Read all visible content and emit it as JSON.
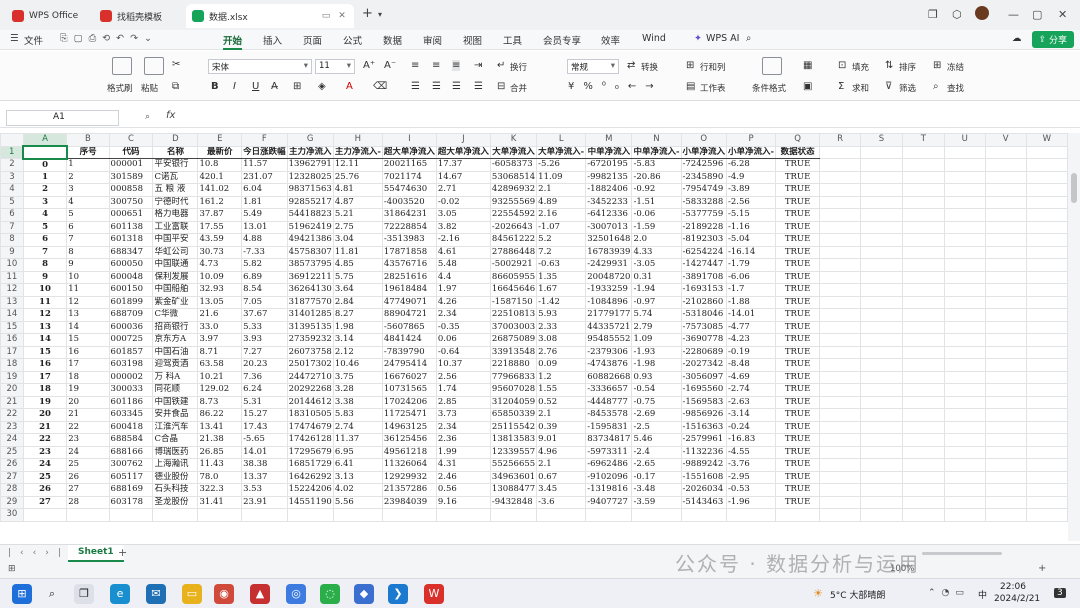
{
  "tabs": [
    {
      "label": "WPS Office",
      "color": "#d9302c"
    },
    {
      "label": "找稻壳模板",
      "color": "#d9302c"
    },
    {
      "label": "数据.xlsx",
      "color": "#16a35a"
    }
  ],
  "menu": [
    "文件",
    "开始",
    "插入",
    "页面",
    "公式",
    "数据",
    "审阅",
    "视图",
    "工具",
    "会员专享",
    "效率",
    "Wind"
  ],
  "wps_ai": "WPS AI",
  "share": "分享",
  "ribbon": {
    "format_brush": "格式刷",
    "paste": "粘贴",
    "font": "宋体",
    "size": "11",
    "wrap": "换行",
    "merge": "合并",
    "numfmt": "常规",
    "convert": "转换",
    "rows_cols": "行和列",
    "worksheet": "工作表",
    "cond_fmt": "条件格式",
    "fill": "填充",
    "sort": "排序",
    "freeze": "冻结",
    "sum": "求和",
    "filter": "筛选",
    "find": "查找"
  },
  "cell_ref": "A1",
  "fx": "fx",
  "col_letters": [
    "A",
    "B",
    "C",
    "D",
    "E",
    "F",
    "G",
    "H",
    "I",
    "J",
    "K",
    "L",
    "M",
    "N",
    "O",
    "P",
    "Q",
    "R",
    "S",
    "T",
    "U",
    "V",
    "W"
  ],
  "header_row": [
    "",
    "序号",
    "代码",
    "名称",
    "最新价",
    "今日涨跌幅",
    "主力净流入",
    "主力净流入-",
    "超大单净流入",
    "超大单净流入",
    "大单净流入",
    "大单净流入-",
    "中单净流入",
    "中单净流入-",
    "小单净流入",
    "小单净流入-",
    "数据状态"
  ],
  "rows": [
    [
      "0",
      "1",
      "000001",
      "平安银行",
      "10.8",
      "11.57",
      "13962791",
      "12.11",
      "20021165",
      "17.37",
      "-6058373",
      "-5.26",
      "-6720195",
      "-5.83",
      "-7242596",
      "-6.28",
      "TRUE"
    ],
    [
      "1",
      "2",
      "301589",
      "C诺瓦",
      "420.1",
      "231.07",
      "12328025",
      "25.76",
      "7021174",
      "14.67",
      "53068514",
      "11.09",
      "-9982135",
      "-20.86",
      "-2345890",
      "-4.9",
      "TRUE"
    ],
    [
      "2",
      "3",
      "000858",
      "五 粮 液",
      "141.02",
      "6.04",
      "98371563",
      "4.81",
      "55474630",
      "2.71",
      "42896932",
      "2.1",
      "-1882406",
      "-0.92",
      "-7954749",
      "-3.89",
      "TRUE"
    ],
    [
      "3",
      "4",
      "300750",
      "宁德时代",
      "161.2",
      "1.81",
      "92855217",
      "4.87",
      "-4003520",
      "-0.02",
      "93255569",
      "4.89",
      "-3452233",
      "-1.51",
      "-5833288",
      "-2.56",
      "TRUE"
    ],
    [
      "4",
      "5",
      "000651",
      "格力电器",
      "37.87",
      "5.49",
      "54418823",
      "5.21",
      "31864231",
      "3.05",
      "22554592",
      "2.16",
      "-6412336",
      "-0.06",
      "-5377759",
      "-5.15",
      "TRUE"
    ],
    [
      "5",
      "6",
      "601138",
      "工业富联",
      "17.55",
      "13.01",
      "51962419",
      "2.75",
      "72228854",
      "3.82",
      "-2026643",
      "-1.07",
      "-3007013",
      "-1.59",
      "-2189228",
      "-1.16",
      "TRUE"
    ],
    [
      "6",
      "7",
      "601318",
      "中国平安",
      "43.59",
      "4.88",
      "49421386",
      "3.04",
      "-3513983",
      "-2.16",
      "84561222",
      "5.2",
      "32501648",
      "2.0",
      "-8192303",
      "-5.04",
      "TRUE"
    ],
    [
      "7",
      "8",
      "688347",
      "华虹公司",
      "30.73",
      "-7.33",
      "45758307",
      "11.81",
      "17871858",
      "4.61",
      "27886448",
      "7.2",
      "16783939",
      "4.33",
      "-6254224",
      "-16.14",
      "TRUE"
    ],
    [
      "8",
      "9",
      "600050",
      "中国联通",
      "4.73",
      "5.82",
      "38573795",
      "4.85",
      "43576716",
      "5.48",
      "-5002921",
      "-0.63",
      "-2429931",
      "-3.05",
      "-1427447",
      "-1.79",
      "TRUE"
    ],
    [
      "9",
      "10",
      "600048",
      "保利发展",
      "10.09",
      "6.89",
      "36912211",
      "5.75",
      "28251616",
      "4.4",
      "86605955",
      "1.35",
      "20048720",
      "0.31",
      "-3891708",
      "-6.06",
      "TRUE"
    ],
    [
      "10",
      "11",
      "600150",
      "中国船舶",
      "32.93",
      "8.54",
      "36264130",
      "3.64",
      "19618484",
      "1.97",
      "16645646",
      "1.67",
      "-1933259",
      "-1.94",
      "-1693153",
      "-1.7",
      "TRUE"
    ],
    [
      "11",
      "12",
      "601899",
      "紫金矿业",
      "13.05",
      "7.05",
      "31877570",
      "2.84",
      "47749071",
      "4.26",
      "-1587150",
      "-1.42",
      "-1084896",
      "-0.97",
      "-2102860",
      "-1.88",
      "TRUE"
    ],
    [
      "12",
      "13",
      "688709",
      "C华微",
      "21.6",
      "37.67",
      "31401285",
      "8.27",
      "88904721",
      "2.34",
      "22510813",
      "5.93",
      "21779177",
      "5.74",
      "-5318046",
      "-14.01",
      "TRUE"
    ],
    [
      "13",
      "14",
      "600036",
      "招商银行",
      "33.0",
      "5.33",
      "31395135",
      "1.98",
      "-5607865",
      "-0.35",
      "37003003",
      "2.33",
      "44335721",
      "2.79",
      "-7573085",
      "-4.77",
      "TRUE"
    ],
    [
      "14",
      "15",
      "000725",
      "京东方A",
      "3.97",
      "3.93",
      "27359232",
      "3.14",
      "4841424",
      "0.06",
      "26875089",
      "3.08",
      "95485552",
      "1.09",
      "-3690778",
      "-4.23",
      "TRUE"
    ],
    [
      "15",
      "16",
      "601857",
      "中国石油",
      "8.71",
      "7.27",
      "26073758",
      "2.12",
      "-7839790",
      "-0.64",
      "33913548",
      "2.76",
      "-2379306",
      "-1.93",
      "-2280689",
      "-0.19",
      "TRUE"
    ],
    [
      "16",
      "17",
      "603198",
      "迎驾贡酒",
      "63.58",
      "20.23",
      "25017302",
      "10.46",
      "24795414",
      "10.37",
      "2218880",
      "0.09",
      "-4743876",
      "-1.98",
      "-2027342",
      "-8.48",
      "TRUE"
    ],
    [
      "17",
      "18",
      "000002",
      "万  科A",
      "10.21",
      "7.36",
      "24472710",
      "3.75",
      "16676027",
      "2.56",
      "77966833",
      "1.2",
      "60882668",
      "0.93",
      "-3056097",
      "-4.69",
      "TRUE"
    ],
    [
      "18",
      "19",
      "300033",
      "同花顺",
      "129.02",
      "6.24",
      "20292268",
      "3.28",
      "10731565",
      "1.74",
      "95607028",
      "1.55",
      "-3336657",
      "-0.54",
      "-1695560",
      "-2.74",
      "TRUE"
    ],
    [
      "19",
      "20",
      "601186",
      "中国铁建",
      "8.73",
      "5.31",
      "20144612",
      "3.38",
      "17024206",
      "2.85",
      "31204059",
      "0.52",
      "-4448777",
      "-0.75",
      "-1569583",
      "-2.63",
      "TRUE"
    ],
    [
      "20",
      "21",
      "603345",
      "安井食品",
      "86.22",
      "15.27",
      "18310505",
      "5.83",
      "11725471",
      "3.73",
      "65850339",
      "2.1",
      "-8453578",
      "-2.69",
      "-9856926",
      "-3.14",
      "TRUE"
    ],
    [
      "21",
      "22",
      "600418",
      "江淮汽车",
      "13.41",
      "17.43",
      "17474679",
      "2.74",
      "14963125",
      "2.34",
      "25115542",
      "0.39",
      "-1595831",
      "-2.5",
      "-1516363",
      "-0.24",
      "TRUE"
    ],
    [
      "22",
      "23",
      "688584",
      "C合晶",
      "21.38",
      "-5.65",
      "17426128",
      "11.37",
      "36125456",
      "2.36",
      "13813583",
      "9.01",
      "83734817",
      "5.46",
      "-2579961",
      "-16.83",
      "TRUE"
    ],
    [
      "23",
      "24",
      "688166",
      "博瑞医药",
      "26.85",
      "14.01",
      "17295679",
      "6.95",
      "49561218",
      "1.99",
      "12339557",
      "4.96",
      "-5973311",
      "-2.4",
      "-1132236",
      "-4.55",
      "TRUE"
    ],
    [
      "24",
      "25",
      "300762",
      "上海瀚讯",
      "11.43",
      "38.38",
      "16851729",
      "6.41",
      "11326064",
      "4.31",
      "55256655",
      "2.1",
      "-6962486",
      "-2.65",
      "-9889242",
      "-3.76",
      "TRUE"
    ],
    [
      "25",
      "26",
      "605117",
      "德业股份",
      "78.0",
      "13.37",
      "16426292",
      "3.13",
      "12929932",
      "2.46",
      "34963601",
      "0.67",
      "-9102096",
      "-0.17",
      "-1551608",
      "-2.95",
      "TRUE"
    ],
    [
      "26",
      "27",
      "688169",
      "石头科技",
      "322.3",
      "3.53",
      "15224206",
      "4.02",
      "21357286",
      "0.56",
      "13088477",
      "3.45",
      "-1319816",
      "-3.48",
      "-2026034",
      "-0.53",
      "TRUE"
    ],
    [
      "27",
      "28",
      "603178",
      "圣龙股份",
      "31.41",
      "23.91",
      "14551190",
      "5.56",
      "23984039",
      "9.16",
      "-9432848",
      "-3.6",
      "-9407727",
      "-3.59",
      "-5143463",
      "-1.96",
      "TRUE"
    ]
  ],
  "sheet": "Sheet1",
  "watermark": "公众号 · 数据分析与运用",
  "zoom": "100%",
  "taskbar": {
    "weather": "5°C 大部晴朗",
    "time": "22:06",
    "date": "2024/2/21",
    "lang": "中",
    "badge": "3"
  }
}
